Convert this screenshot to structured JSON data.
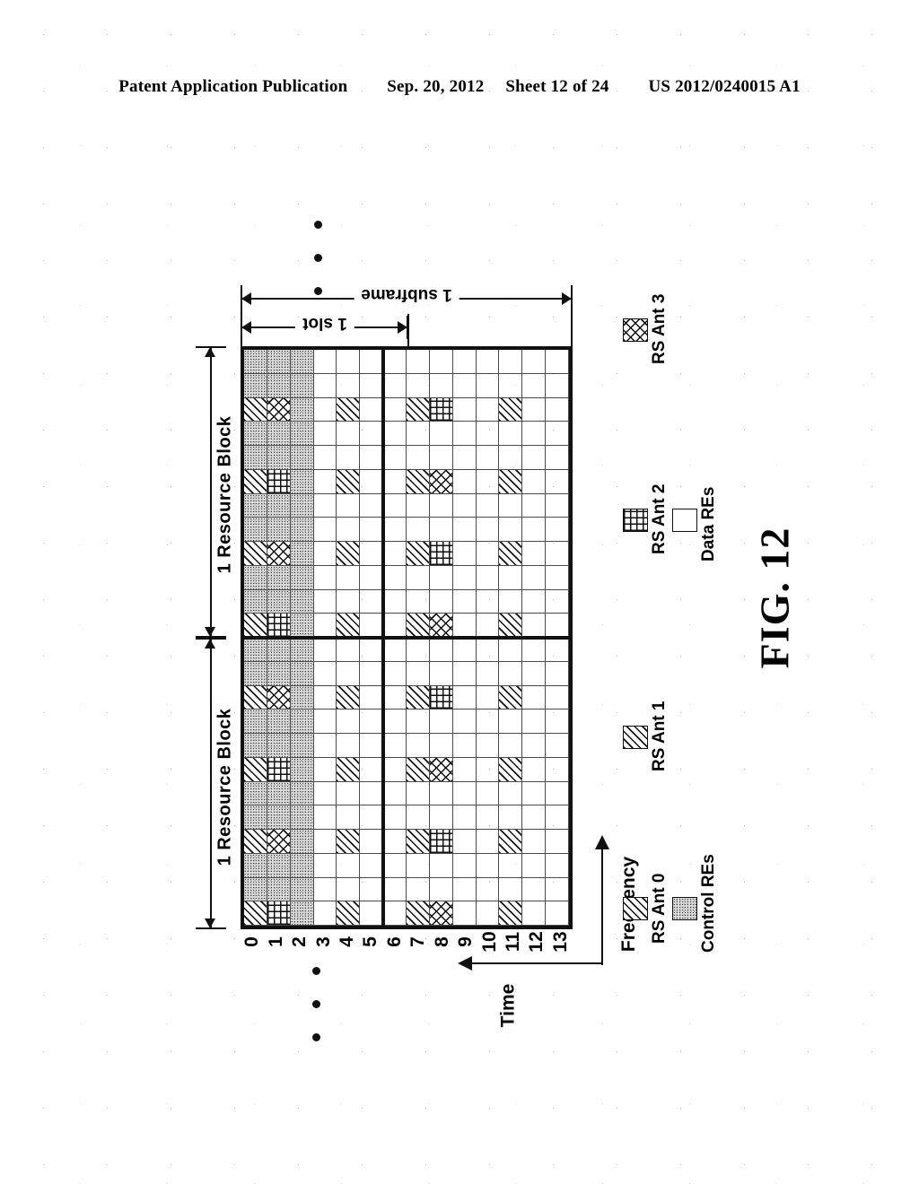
{
  "header": {
    "publication": "Patent Application Publication",
    "date": "Sep. 20, 2012",
    "sheet": "Sheet 12 of 24",
    "document_number": "US 2012/0240015 A1"
  },
  "figure": {
    "label": "FIG. 12",
    "axes": {
      "vertical": "Frequency",
      "horizontal": "Time"
    },
    "spans": {
      "subframe": "1 subframe",
      "slot": "1 slot"
    },
    "resource_blocks": [
      {
        "label": "1 Resource Block"
      },
      {
        "label": "1 Resource Block"
      }
    ],
    "column_indices": [
      "0",
      "1",
      "2",
      "3",
      "4",
      "5",
      "6",
      "7",
      "8",
      "9",
      "10",
      "11",
      "12",
      "13"
    ],
    "legend": [
      {
        "id": "rs-ant-0",
        "label": "RS Ant 0",
        "pattern": "diagonal-hatch"
      },
      {
        "id": "control",
        "label": "Control REs",
        "pattern": "stipple"
      },
      {
        "id": "rs-ant-1",
        "label": "RS Ant 1",
        "pattern": "diagonal-hatch"
      },
      {
        "id": "rs-ant-2",
        "label": "RS Ant 2",
        "pattern": "square-grid"
      },
      {
        "id": "data",
        "label": "Data REs",
        "pattern": "blank"
      },
      {
        "id": "rs-ant-3",
        "label": "RS Ant 3",
        "pattern": "cross-hatch"
      }
    ]
  },
  "chart_data": {
    "type": "heatmap",
    "title": "FIG. 12",
    "xlabel": "Time",
    "ylabel": "Frequency",
    "columns": 14,
    "rows": 24,
    "column_labels": [
      "0",
      "1",
      "2",
      "3",
      "4",
      "5",
      "6",
      "7",
      "8",
      "9",
      "10",
      "11",
      "12",
      "13"
    ],
    "slot_boundary_after_column": 6,
    "resource_block_boundary_after_row": 11,
    "cell_types": [
      "control",
      "ant0",
      "ant1",
      "ant2",
      "ant3",
      "data"
    ],
    "legend_mapping": {
      "control": "Control REs",
      "ant0": "RS Ant 0",
      "ant1": "RS Ant 1",
      "ant2": "RS Ant 2",
      "ant3": "RS Ant 3",
      "data": "Data REs"
    },
    "grid": [
      [
        "control",
        "control",
        "control",
        "data",
        "data",
        "data",
        "data",
        "data",
        "data",
        "data",
        "data",
        "data",
        "data",
        "data"
      ],
      [
        "control",
        "control",
        "control",
        "data",
        "data",
        "data",
        "data",
        "data",
        "data",
        "data",
        "data",
        "data",
        "data",
        "data"
      ],
      [
        "ant0",
        "ant3",
        "control",
        "data",
        "ant0",
        "data",
        "data",
        "ant0",
        "ant2",
        "data",
        "data",
        "ant0",
        "data",
        "data"
      ],
      [
        "control",
        "control",
        "control",
        "data",
        "data",
        "data",
        "data",
        "data",
        "data",
        "data",
        "data",
        "data",
        "data",
        "data"
      ],
      [
        "control",
        "control",
        "control",
        "data",
        "data",
        "data",
        "data",
        "data",
        "data",
        "data",
        "data",
        "data",
        "data",
        "data"
      ],
      [
        "ant0",
        "ant2",
        "control",
        "data",
        "ant0",
        "data",
        "data",
        "ant0",
        "ant3",
        "data",
        "data",
        "ant0",
        "data",
        "data"
      ],
      [
        "control",
        "control",
        "control",
        "data",
        "data",
        "data",
        "data",
        "data",
        "data",
        "data",
        "data",
        "data",
        "data",
        "data"
      ],
      [
        "control",
        "control",
        "control",
        "data",
        "data",
        "data",
        "data",
        "data",
        "data",
        "data",
        "data",
        "data",
        "data",
        "data"
      ],
      [
        "ant0",
        "ant3",
        "control",
        "data",
        "ant0",
        "data",
        "data",
        "ant0",
        "ant2",
        "data",
        "data",
        "ant0",
        "data",
        "data"
      ],
      [
        "control",
        "control",
        "control",
        "data",
        "data",
        "data",
        "data",
        "data",
        "data",
        "data",
        "data",
        "data",
        "data",
        "data"
      ],
      [
        "control",
        "control",
        "control",
        "data",
        "data",
        "data",
        "data",
        "data",
        "data",
        "data",
        "data",
        "data",
        "data",
        "data"
      ],
      [
        "ant0",
        "ant2",
        "control",
        "data",
        "ant0",
        "data",
        "data",
        "ant0",
        "ant3",
        "data",
        "data",
        "ant0",
        "data",
        "data"
      ],
      [
        "control",
        "control",
        "control",
        "data",
        "data",
        "data",
        "data",
        "data",
        "data",
        "data",
        "data",
        "data",
        "data",
        "data"
      ],
      [
        "control",
        "control",
        "control",
        "data",
        "data",
        "data",
        "data",
        "data",
        "data",
        "data",
        "data",
        "data",
        "data",
        "data"
      ],
      [
        "ant0",
        "ant3",
        "control",
        "data",
        "ant0",
        "data",
        "data",
        "ant0",
        "ant2",
        "data",
        "data",
        "ant0",
        "data",
        "data"
      ],
      [
        "control",
        "control",
        "control",
        "data",
        "data",
        "data",
        "data",
        "data",
        "data",
        "data",
        "data",
        "data",
        "data",
        "data"
      ],
      [
        "control",
        "control",
        "control",
        "data",
        "data",
        "data",
        "data",
        "data",
        "data",
        "data",
        "data",
        "data",
        "data",
        "data"
      ],
      [
        "ant0",
        "ant2",
        "control",
        "data",
        "ant0",
        "data",
        "data",
        "ant0",
        "ant3",
        "data",
        "data",
        "ant0",
        "data",
        "data"
      ],
      [
        "control",
        "control",
        "control",
        "data",
        "data",
        "data",
        "data",
        "data",
        "data",
        "data",
        "data",
        "data",
        "data",
        "data"
      ],
      [
        "control",
        "control",
        "control",
        "data",
        "data",
        "data",
        "data",
        "data",
        "data",
        "data",
        "data",
        "data",
        "data",
        "data"
      ],
      [
        "ant0",
        "ant3",
        "control",
        "data",
        "ant0",
        "data",
        "data",
        "ant0",
        "ant2",
        "data",
        "data",
        "ant0",
        "data",
        "data"
      ],
      [
        "control",
        "control",
        "control",
        "data",
        "data",
        "data",
        "data",
        "data",
        "data",
        "data",
        "data",
        "data",
        "data",
        "data"
      ],
      [
        "control",
        "control",
        "control",
        "data",
        "data",
        "data",
        "data",
        "data",
        "data",
        "data",
        "data",
        "data",
        "data",
        "data"
      ],
      [
        "ant0",
        "ant2",
        "control",
        "data",
        "ant0",
        "data",
        "data",
        "ant0",
        "ant3",
        "data",
        "data",
        "ant0",
        "data",
        "data"
      ]
    ]
  }
}
